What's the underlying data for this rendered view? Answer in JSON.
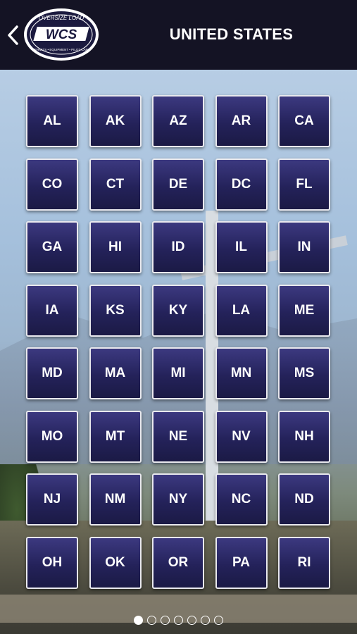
{
  "header": {
    "title": "UNITED STATES",
    "back_icon": "chevron-left-icon",
    "logo": {
      "top_text": "OVERSIZE LOAD",
      "main_text": "WCS",
      "bottom_text": "PERMITS • EQUIPMENT • PILOT CARS"
    }
  },
  "states": [
    {
      "code": "AL"
    },
    {
      "code": "AK"
    },
    {
      "code": "AZ"
    },
    {
      "code": "AR"
    },
    {
      "code": "CA"
    },
    {
      "code": "CO"
    },
    {
      "code": "CT"
    },
    {
      "code": "DE"
    },
    {
      "code": "DC"
    },
    {
      "code": "FL"
    },
    {
      "code": "GA"
    },
    {
      "code": "HI"
    },
    {
      "code": "ID"
    },
    {
      "code": "IL"
    },
    {
      "code": "IN"
    },
    {
      "code": "IA"
    },
    {
      "code": "KS"
    },
    {
      "code": "KY"
    },
    {
      "code": "LA"
    },
    {
      "code": "ME"
    },
    {
      "code": "MD"
    },
    {
      "code": "MA"
    },
    {
      "code": "MI"
    },
    {
      "code": "MN"
    },
    {
      "code": "MS"
    },
    {
      "code": "MO"
    },
    {
      "code": "MT"
    },
    {
      "code": "NE"
    },
    {
      "code": "NV"
    },
    {
      "code": "NH"
    },
    {
      "code": "NJ"
    },
    {
      "code": "NM"
    },
    {
      "code": "NY"
    },
    {
      "code": "NC"
    },
    {
      "code": "ND"
    },
    {
      "code": "OH"
    },
    {
      "code": "OK"
    },
    {
      "code": "OR"
    },
    {
      "code": "PA"
    },
    {
      "code": "RI"
    }
  ],
  "pagination": {
    "total_pages": 7,
    "current_page": 1
  },
  "colors": {
    "header_bg": "#141324",
    "tile_top": "#3c3980",
    "tile_bottom": "#1b1a45",
    "tile_border": "#e9e9ee",
    "text": "#ffffff"
  }
}
